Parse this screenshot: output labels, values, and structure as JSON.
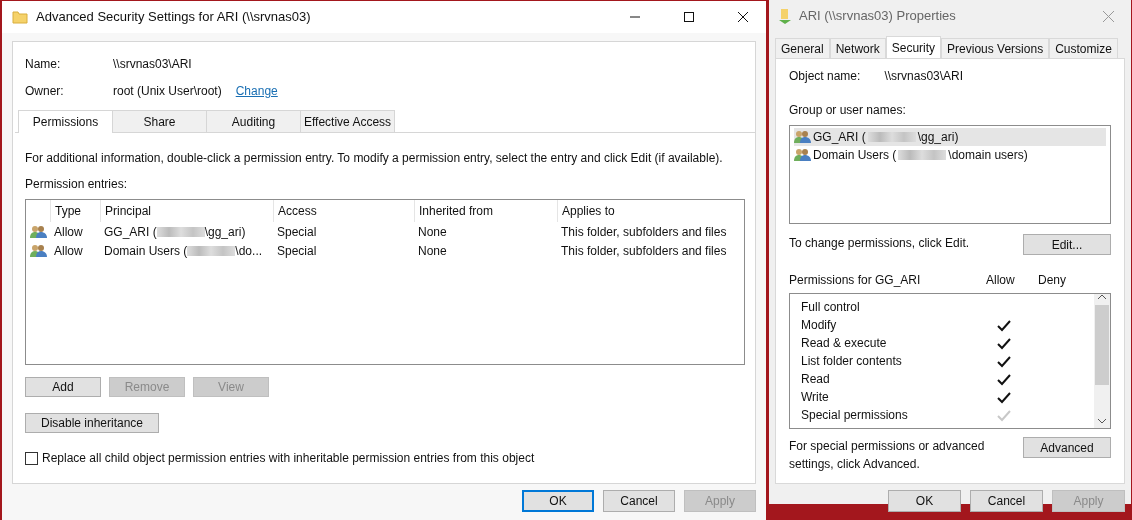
{
  "advanced_window": {
    "title": "Advanced Security Settings for ARI (\\\\srvnas03)",
    "fields": [
      {
        "label": "Name:",
        "value": "\\\\srvnas03\\ARI"
      },
      {
        "label": "Owner:",
        "value": "root (Unix User\\root)",
        "link": "Change"
      }
    ],
    "tabs": [
      {
        "label": "Permissions",
        "selected": true
      },
      {
        "label": "Share",
        "selected": false
      },
      {
        "label": "Auditing",
        "selected": false
      },
      {
        "label": "Effective Access",
        "selected": false
      }
    ],
    "info": "For additional information, double-click a permission entry. To modify a permission entry, select the entry and click Edit (if available).",
    "entries_label": "Permission entries:",
    "table": {
      "columns": [
        "Type",
        "Principal",
        "Access",
        "Inherited from",
        "Applies to"
      ],
      "rows": [
        {
          "type": "Allow",
          "principal_before": "GG_ARI (",
          "redacted": true,
          "principal_after": "\\gg_ari)",
          "access": "Special",
          "inherited_from": "None",
          "applies_to": "This folder, subfolders and files"
        },
        {
          "type": "Allow",
          "principal_before": "Domain Users (",
          "redacted": true,
          "principal_after": "\\do...",
          "access": "Special",
          "inherited_from": "None",
          "applies_to": "This folder, subfolders and files"
        }
      ]
    },
    "entry_buttons": [
      {
        "label": "Add",
        "disabled": false
      },
      {
        "label": "Remove",
        "disabled": true
      },
      {
        "label": "View",
        "disabled": true
      }
    ],
    "inheritance_button": "Disable inheritance",
    "replace_checkbox": {
      "label": "Replace all child object permission entries with inheritable permission entries from this object",
      "checked": false
    },
    "footer_buttons": [
      {
        "label": "OK",
        "disabled": false,
        "default": true
      },
      {
        "label": "Cancel",
        "disabled": false,
        "default": false
      },
      {
        "label": "Apply",
        "disabled": true,
        "default": false
      }
    ]
  },
  "properties_window": {
    "title": "ARI (\\\\srvnas03) Properties",
    "tabs": [
      {
        "label": "General",
        "selected": false
      },
      {
        "label": "Network",
        "selected": false
      },
      {
        "label": "Security",
        "selected": true
      },
      {
        "label": "Previous Versions",
        "selected": false
      },
      {
        "label": "Customize",
        "selected": false
      }
    ],
    "object_label": "Object name:",
    "object_value": "\\\\srvnas03\\ARI",
    "groups_label": "Group or user names:",
    "groups": [
      {
        "before": "GG_ARI (",
        "redacted": true,
        "after": "\\gg_ari)",
        "selected": true
      },
      {
        "before": "Domain Users (",
        "redacted": true,
        "after": "\\domain users)",
        "selected": false
      }
    ],
    "change_hint": "To change permissions, click Edit.",
    "edit_button": "Edit...",
    "permissions_label": "Permissions for GG_ARI",
    "allow_label": "Allow",
    "deny_label": "Deny",
    "permissions": [
      {
        "name": "Full control",
        "allow": false,
        "deny": false
      },
      {
        "name": "Modify",
        "allow": true,
        "deny": false,
        "inherited": false
      },
      {
        "name": "Read & execute",
        "allow": true,
        "deny": false,
        "inherited": false
      },
      {
        "name": "List folder contents",
        "allow": true,
        "deny": false,
        "inherited": false
      },
      {
        "name": "Read",
        "allow": true,
        "deny": false,
        "inherited": false
      },
      {
        "name": "Write",
        "allow": true,
        "deny": false,
        "inherited": false
      },
      {
        "name": "Special permissions",
        "allow": true,
        "deny": false,
        "inherited": true
      }
    ],
    "advanced_hint": "For special permissions or advanced settings, click Advanced.",
    "advanced_button": "Advanced",
    "footer_buttons": [
      {
        "label": "OK",
        "disabled": false
      },
      {
        "label": "Cancel",
        "disabled": false
      },
      {
        "label": "Apply",
        "disabled": true
      }
    ]
  }
}
